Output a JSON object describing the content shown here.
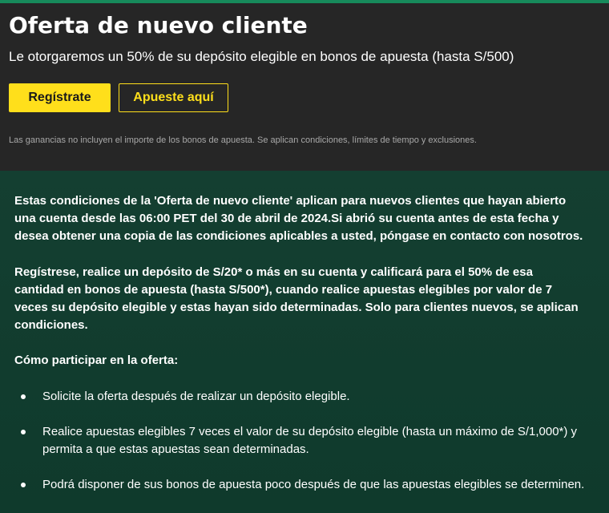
{
  "hero": {
    "title": "Oferta de nuevo cliente",
    "subtitle": "Le otorgaremos un 50% de su depósito elegible en bonos de apuesta (hasta S/500)",
    "register_label": "Regístrate",
    "bet_label": "Apueste aquí",
    "disclaimer": "Las ganancias no incluyen el importe de los bonos de apuesta. Se aplican condiciones, límites de tiempo y exclusiones."
  },
  "terms": {
    "paragraph1": "Estas condiciones de la 'Oferta de nuevo cliente' aplican para nuevos clientes que hayan abierto una cuenta desde las 06:00 PET del 30 de abril de 2024.Si abrió su cuenta antes de esta fecha y desea obtener una copia de las condiciones aplicables a usted, póngase en contacto con nosotros.",
    "paragraph2": "Regístrese, realice un depósito de S/20* o más en su cuenta y calificará para el 50% de esa cantidad en bonos de apuesta (hasta S/500*), cuando realice apuestas elegibles por valor de 7 veces su depósito elegible y estas hayan sido determinadas. Solo para clientes nuevos, se aplican condiciones.",
    "how_title": "Cómo participar en la oferta:",
    "steps": [
      "Solicite la oferta después de realizar un depósito elegible.",
      "Realice apuestas elegibles 7 veces el valor de su depósito elegible (hasta un máximo de S/1,000*) y permita a que estas apuestas sean determinadas.",
      "Podrá disponer de sus bonos de apuesta poco después de que las apuestas elegibles se determinen."
    ]
  },
  "colors": {
    "accent": "#ffdf1b",
    "hero_bg": "#262626",
    "terms_bg": "#0f3a2c",
    "top_bar": "#178a5b"
  }
}
